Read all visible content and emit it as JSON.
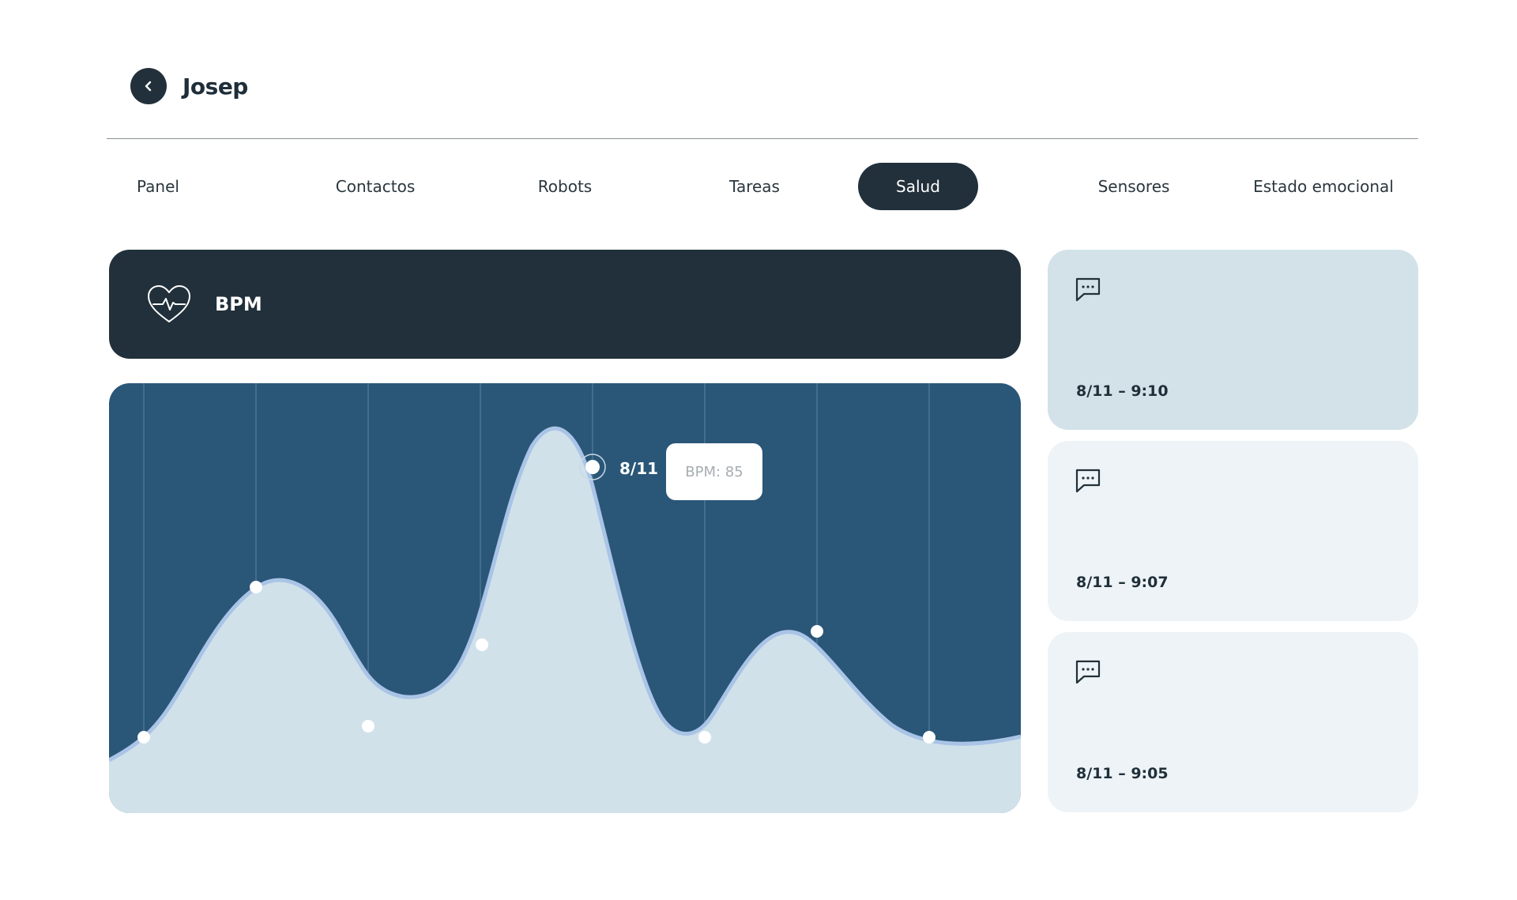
{
  "header": {
    "user_name": "Josep"
  },
  "tabs": [
    {
      "label": "Panel",
      "active": false
    },
    {
      "label": "Contactos",
      "active": false
    },
    {
      "label": "Robots",
      "active": false
    },
    {
      "label": "Tareas",
      "active": false
    },
    {
      "label": "Salud",
      "active": true
    },
    {
      "label": "Sensores",
      "active": false
    },
    {
      "label": "Estado emocional",
      "active": false
    }
  ],
  "bpm": {
    "title": "BPM",
    "icon": "heart-pulse-icon"
  },
  "tooltip": {
    "date": "8/11",
    "value_text": "BPM: 85"
  },
  "messages": [
    {
      "time": "8/11 – 9:10",
      "icon": "chat-bubble-icon",
      "highlighted": true
    },
    {
      "time": "8/11 – 9:07",
      "icon": "chat-bubble-icon",
      "highlighted": false
    },
    {
      "time": "8/11 – 9:05",
      "icon": "chat-bubble-icon",
      "highlighted": false
    }
  ],
  "colors": {
    "dark": "#21303a",
    "chart_bg": "#2a5678",
    "chart_fill": "#d0e1ea",
    "chart_line": "#a9c4e6",
    "card_highlight": "#d3e2e9",
    "card_default": "#edf3f6"
  }
}
